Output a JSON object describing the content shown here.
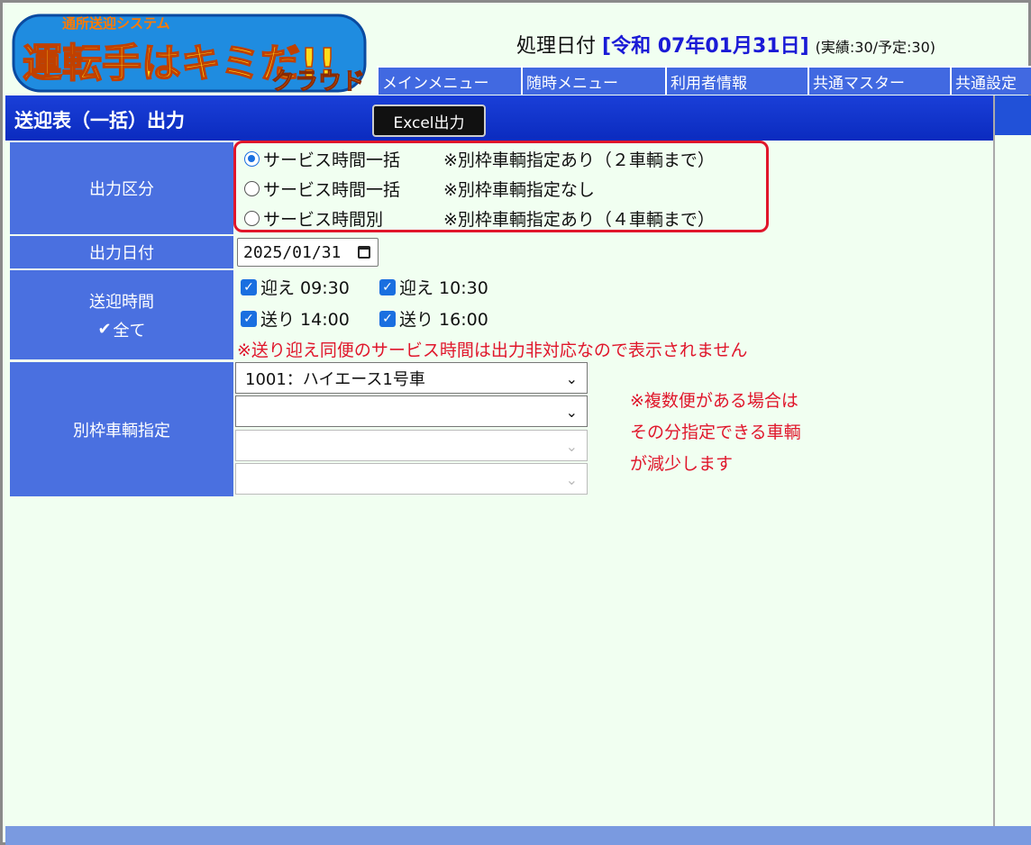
{
  "header": {
    "logo_tagline": "通所送迎システム",
    "logo_main": "運転手はキミだ!!",
    "logo_sub": "クラウド",
    "proc_date_label": "処理日付",
    "proc_date_value": "[令和 07年01月31日]",
    "proc_date_stats": "(実績:30/予定:30)"
  },
  "nav": {
    "items": [
      "メインメニュー",
      "随時メニュー",
      "利用者情報",
      "共通マスター",
      "共通設定"
    ]
  },
  "page": {
    "title": "送迎表（一括）出力",
    "excel_button": "Excel出力"
  },
  "form": {
    "output_type": {
      "label": "出力区分",
      "options": [
        {
          "label": "サービス時間一括",
          "note": "※別枠車輌指定あり（２車輌まで）",
          "selected": true
        },
        {
          "label": "サービス時間一括",
          "note": "※別枠車輌指定なし",
          "selected": false
        },
        {
          "label": "サービス時間別",
          "note": "※別枠車輌指定あり（４車輌まで）",
          "selected": false
        }
      ]
    },
    "output_date": {
      "label": "出力日付",
      "value": "2025/01/31"
    },
    "pickup_time": {
      "label": "送迎時間",
      "all_label": "全て",
      "items": [
        "迎え 09:30",
        "迎え 10:30",
        "送り 14:00",
        "送り 16:00"
      ],
      "warning": "※送り迎え同便のサービス時間は出力非対応なので表示されません"
    },
    "vehicle": {
      "label": "別枠車輌指定",
      "selects": [
        "1001：ハイエース1号車",
        "",
        "",
        ""
      ],
      "note_lines": [
        "※複数便がある場合は",
        "その分指定できる車輌",
        "が減少します"
      ]
    }
  },
  "colors": {
    "accent_blue": "#4169e1",
    "title_blue": "#0b2bbf",
    "warning_red": "#e0162b",
    "background": "#f1fff1"
  }
}
